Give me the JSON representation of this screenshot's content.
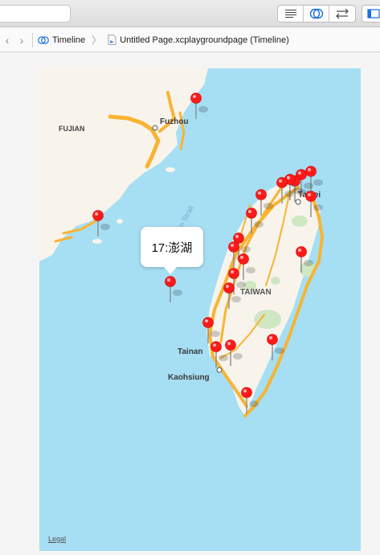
{
  "breadcrumb": {
    "timeline_label": "Timeline",
    "page_label": "Untitled Page.xcplaygroundpage (Timeline)"
  },
  "map": {
    "labels": {
      "fujian": "FUJIAN",
      "fuzhou": "Fuzhou",
      "strait": "Taiwan Strait",
      "taipei": "Taipei",
      "taiwan": "TAIWAN",
      "tainan": "Tainan",
      "kaohsiung": "Kaohsiung"
    },
    "legal": "Legal",
    "callout": "17:澎湖",
    "pin_color": "#ff1a1a",
    "road_color": "#f8b432",
    "water_color": "#a6dff4",
    "land_color": "#f8f4ec"
  }
}
